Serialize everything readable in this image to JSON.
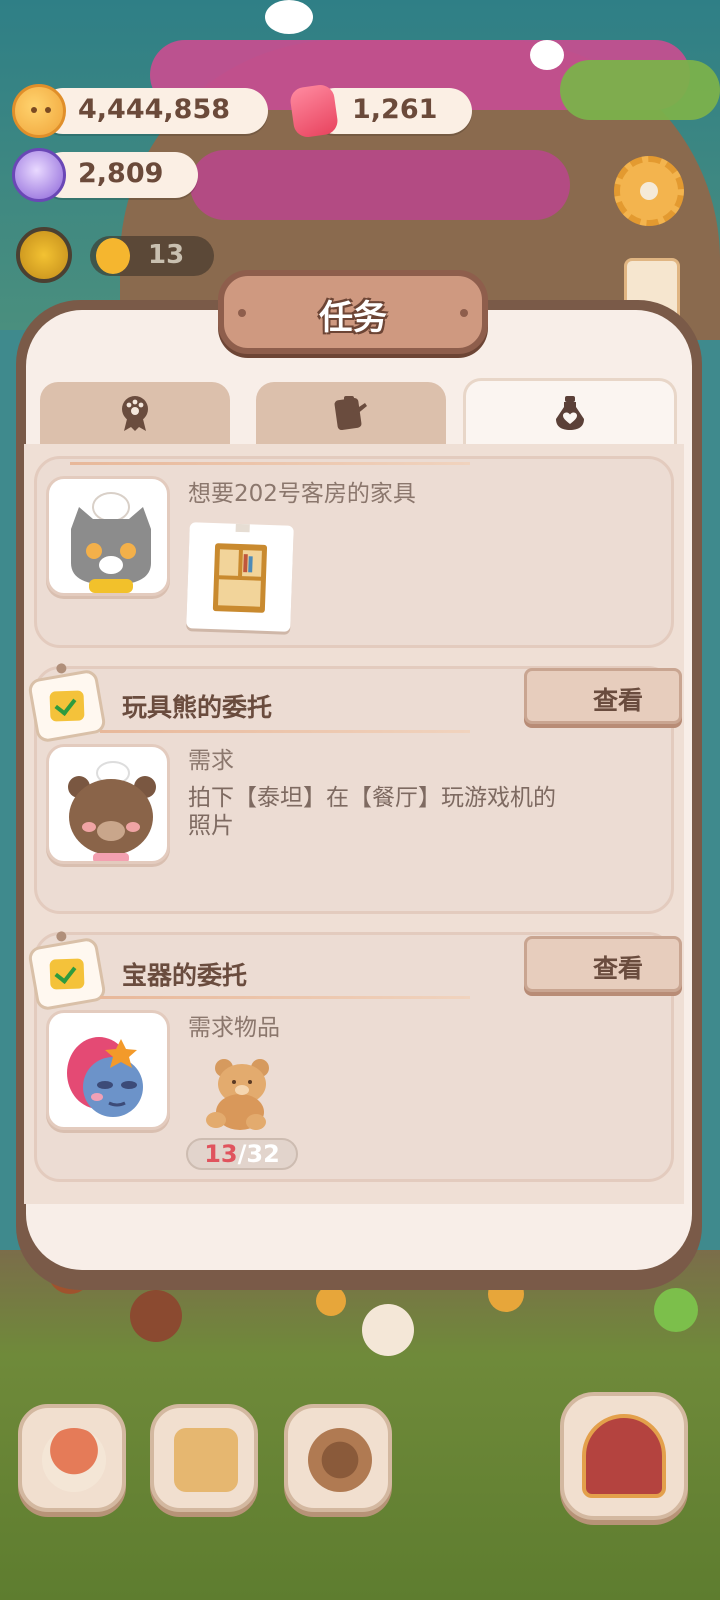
{
  "resources": {
    "coins": "4,444,858",
    "gems": "1,261",
    "crystals": "2,809",
    "guest_count": "13"
  },
  "modal": {
    "title": "任务",
    "tabs": [
      {
        "icon": "paw-badge-icon",
        "active": false
      },
      {
        "icon": "clipboard-icon",
        "active": false
      },
      {
        "icon": "heart-potion-icon",
        "active": true
      }
    ]
  },
  "tasks": [
    {
      "requirement": "想要202号客房的家具",
      "avatar": "gray-cat-avatar-icon",
      "item": "bookshelf-icon"
    },
    {
      "title": "玩具熊的委托",
      "view_label": "查看",
      "requirement_label": "需求",
      "requirement_line1": "拍下【泰坦】在【餐厅】玩游戏机的",
      "requirement_line2": "照片",
      "avatar": "teddy-bear-avatar-icon"
    },
    {
      "title": "宝器的委托",
      "view_label": "查看",
      "requirement_label": "需求物品",
      "avatar": "zombie-girl-avatar-icon",
      "item": "teddy-bear-item-icon",
      "progress_current": "13",
      "progress_separator": "/",
      "progress_total": "32"
    }
  ],
  "bottom_nav": [
    {
      "icon": "mushroom-house-icon"
    },
    {
      "icon": "calendar-heart-icon"
    },
    {
      "icon": "food-plate-icon"
    },
    {
      "icon": "stage-theater-icon"
    }
  ],
  "colors": {
    "accent": "#cf9980",
    "panel": "#f8eee8",
    "progress_current": "#e0535d"
  }
}
